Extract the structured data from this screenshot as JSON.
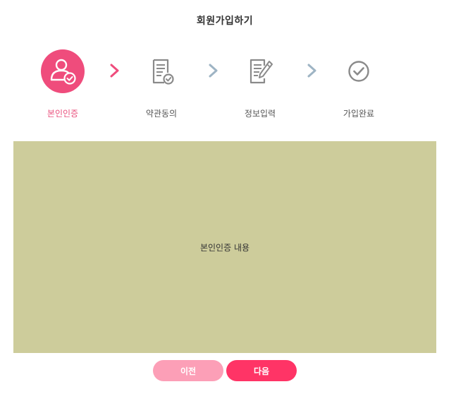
{
  "header": {
    "title": "회원가입하기"
  },
  "steps": [
    {
      "label": "본인인증",
      "icon": "user-check-icon",
      "active": true
    },
    {
      "label": "약관동의",
      "icon": "document-check-icon",
      "active": false
    },
    {
      "label": "정보입력",
      "icon": "document-edit-icon",
      "active": false
    },
    {
      "label": "가입완료",
      "icon": "check-circle-icon",
      "active": false
    }
  ],
  "content": {
    "text": "본인인증 내용"
  },
  "buttons": {
    "prev_label": "이전",
    "next_label": "다음"
  },
  "colors": {
    "accent": "#ef4c7c",
    "active_arrow": "#ef4c7c",
    "inactive_arrow": "#9eb4c4",
    "content_bg": "#cdcc9b",
    "prev_button": "#fc9fb7",
    "next_button": "#ff3466"
  }
}
